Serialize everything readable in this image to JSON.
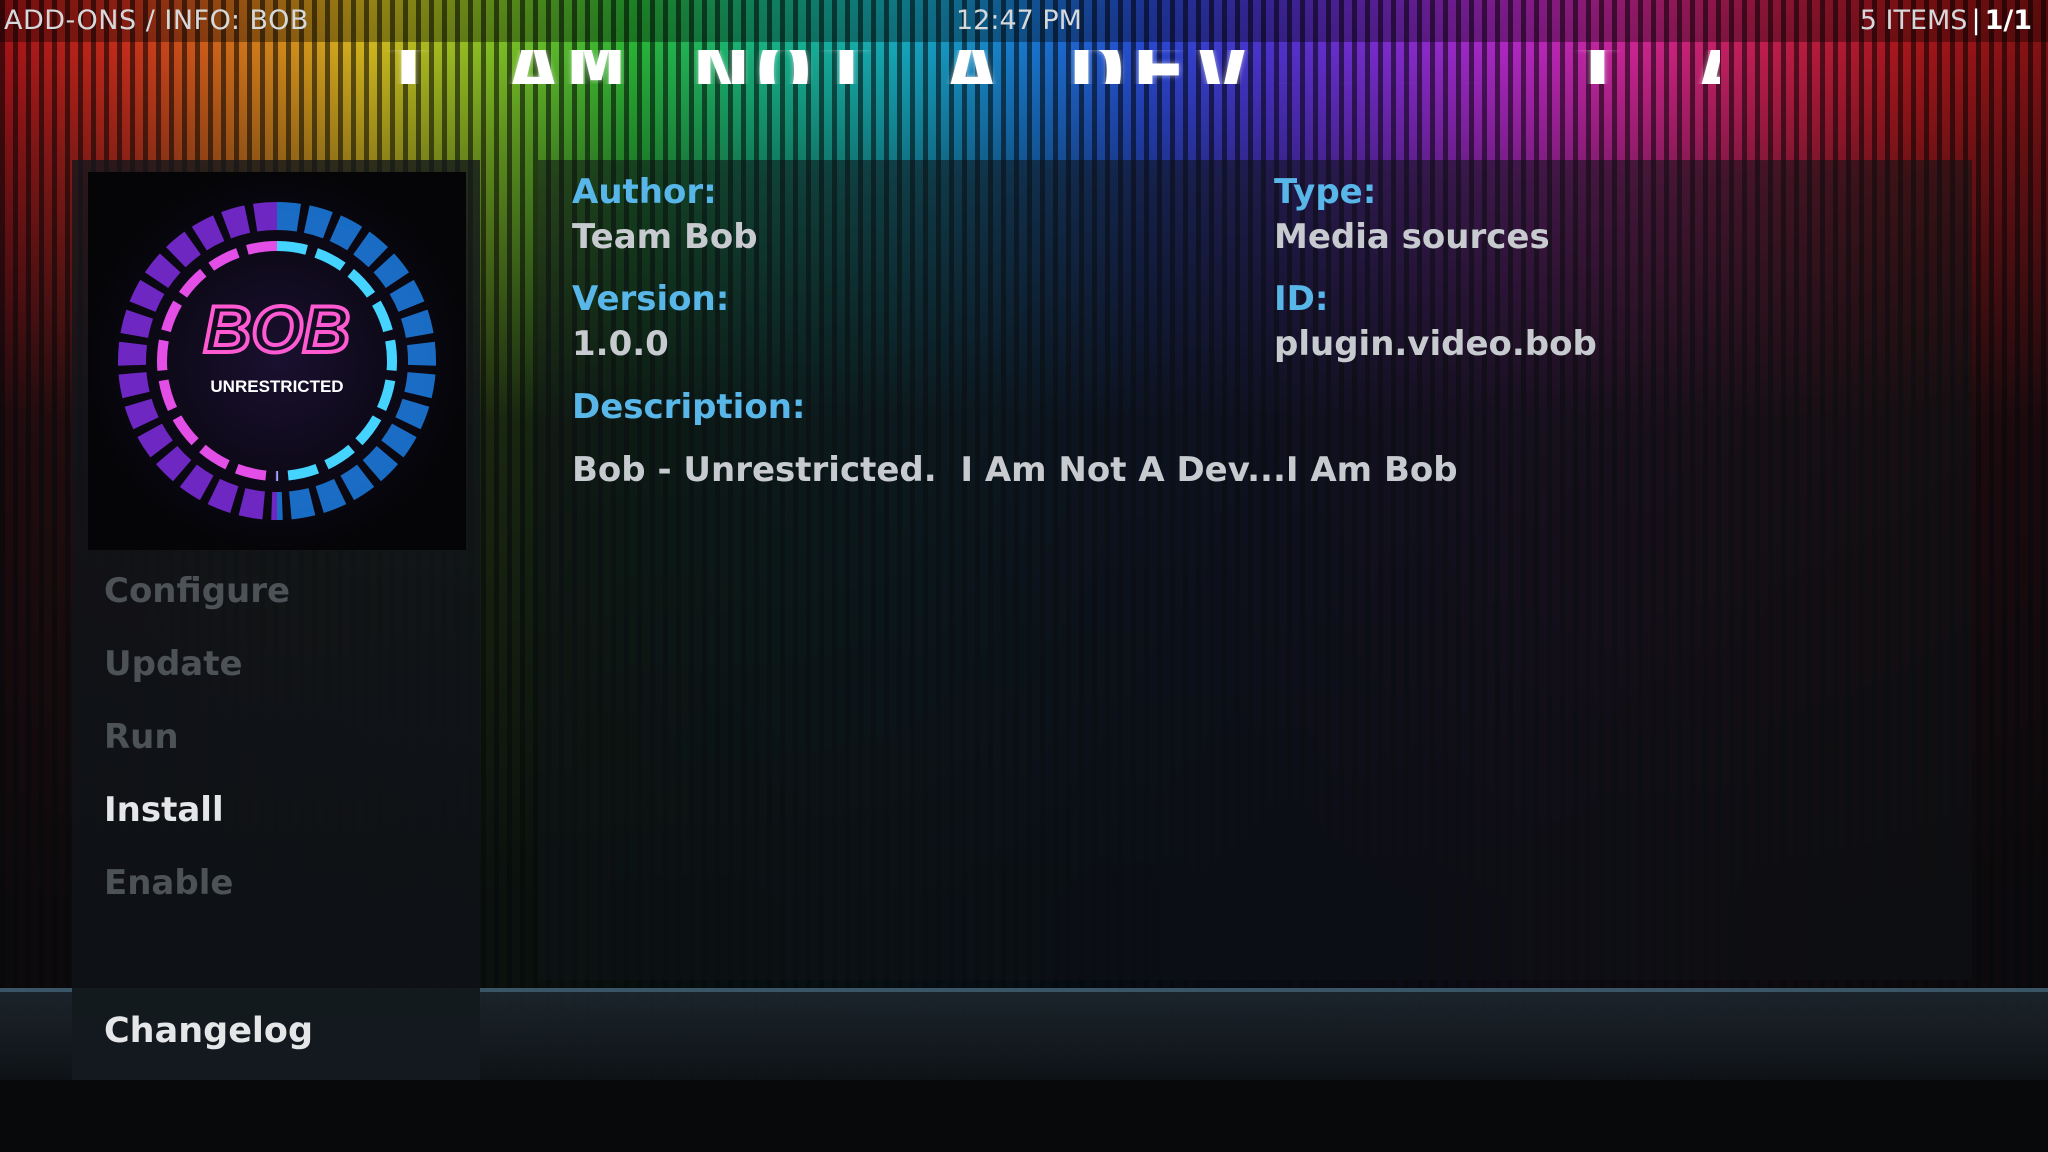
{
  "top_bar": {
    "breadcrumb": "ADD-ONS / INFO: BOB",
    "time": "12:47 PM",
    "item_count": "5 ITEMS",
    "separator": "|",
    "page": "1/1"
  },
  "fanart": {
    "banner_text": "I AM NOT A DEV.... I AM BOB"
  },
  "addon_icon": {
    "logo_text": "BOB",
    "subtitle": "UNRESTRICTED"
  },
  "menu": {
    "items": [
      {
        "label": "Configure"
      },
      {
        "label": "Update"
      },
      {
        "label": "Run"
      },
      {
        "label": "Install"
      },
      {
        "label": "Enable"
      }
    ],
    "changelog": "Changelog"
  },
  "info": {
    "author_label": "Author:",
    "author_value": "Team Bob",
    "type_label": "Type:",
    "type_value": "Media sources",
    "version_label": "Version:",
    "version_value": "1.0.0",
    "id_label": "ID:",
    "id_value": "plugin.video.bob",
    "description_label": "Description:",
    "description_value": "Bob - Unrestricted.  I Am Not A Dev...I Am Bob"
  },
  "colors": {
    "accent_label": "#58b6e8",
    "text_primary": "#e4e6e8",
    "text_disabled": "#4d5257"
  }
}
